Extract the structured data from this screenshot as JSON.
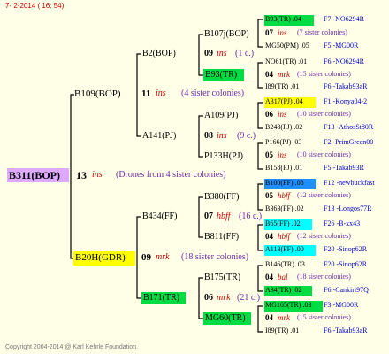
{
  "header": "7-  2-2014 ( 16: 54)",
  "copyright": "Copyright 2004-2014 @ Karl Kehrle Foundation.",
  "colors": {
    "green": "#00dd44",
    "cyan": "#00ffff",
    "yellow": "#ffff00",
    "blue": "#1e8fff",
    "lilac": "#ddaaff",
    "line": "#000000"
  },
  "tree": {
    "root": "B311(BOP)",
    "root_gen": "13",
    "root_ins": "ins",
    "root_note": "(Drones from 4 sister colonies)",
    "p1": {
      "name": "B109(BOP)",
      "gen": "11",
      "ins": "ins",
      "note": "(4 sister colonies)",
      "gp1": {
        "name": "B2(BOP)",
        "ggp1": {
          "name": "B107j(BOP)",
          "gen": "09",
          "ins": "ins",
          "note": "(1 c.)"
        },
        "ggp2": {
          "name": "B93(TR)"
        }
      },
      "gp2": {
        "name": "A141(PJ)",
        "ggp1": {
          "name": "A109(PJ)",
          "gen": "08",
          "ins": "ins",
          "note": "(9 c.)"
        },
        "ggp2": {
          "name": "P133H(PJ)"
        }
      }
    },
    "p2": {
      "name": "B20H(GDR)",
      "gen": "09",
      "ins": "mrk",
      "note": "(18 sister colonies)",
      "gp1": {
        "name": "B434(FF)",
        "ggp1": {
          "name": "B380(FF)",
          "gen": "07",
          "ins": "hbff",
          "note": "(16 c.)"
        },
        "ggp2": {
          "name": "B811(FF)"
        }
      },
      "gp2": {
        "name": "B171(TR)",
        "ggp1": {
          "name": "B175(TR)",
          "gen": "06",
          "ins": "mrk",
          "note": "(21 c.)"
        },
        "ggp2": {
          "name": "MG60(TR)"
        }
      }
    }
  },
  "right": [
    {
      "a": "B93(TR) .04",
      "b": "F7 -NO6294R"
    },
    {
      "gen": "07",
      "ins": "ins",
      "note": "(7 sister colonies)"
    },
    {
      "a": "MG50(PM) .05",
      "b": "F5 -MG00R"
    },
    {
      "a": "NO61(TR) .01",
      "b": "F6 -NO6294R"
    },
    {
      "gen": "04",
      "ins": "mrk",
      "note": "(15 sister colonies)"
    },
    {
      "a": "I89(TR) .01",
      "b": "F6 -Takab93aR"
    },
    {
      "a": "A317(PJ) .04",
      "b": "F1 -Konya04-2"
    },
    {
      "gen": "06",
      "ins": "ins",
      "note": "(10 sister colonies)"
    },
    {
      "a": "B248(PJ) .02",
      "b": "F13 -AthosSt80R"
    },
    {
      "a": "P166(PJ) .03",
      "b": "F2 -PrimGreen00"
    },
    {
      "gen": "05",
      "ins": "ins",
      "note": "(10 sister colonies)"
    },
    {
      "a": "B158(PJ) .01",
      "b": "F5 -Takab93R"
    },
    {
      "a": "B100(FF) .08",
      "b": "F12 -newbuckfast"
    },
    {
      "gen": "05",
      "ins": "hbff",
      "note": "(12 sister colonies)"
    },
    {
      "a": "B363(FF) .02",
      "b": "F13 -Longos77R"
    },
    {
      "a": "B65(FF) .02",
      "b": "F26 -B-xx43"
    },
    {
      "gen": "04",
      "ins": "hbff",
      "note": "(12 sister colonies)"
    },
    {
      "a": "A113(FF) .00",
      "b": "F20 -Sinop62R"
    },
    {
      "a": "B146(TR) .03",
      "b": "F20 -Sinop62R"
    },
    {
      "gen": "04",
      "ins": "bal",
      "note": "(18 sister colonies)"
    },
    {
      "a": "A34(TR) .02",
      "b": "F6 -Cankiri97Q"
    },
    {
      "a": "MG165(TR) .03",
      "b": "F3 -MG00R"
    },
    {
      "gen": "04",
      "ins": "mrk",
      "note": "(15 sister colonies)"
    },
    {
      "a": "I89(TR) .01",
      "b": "F6 -Takab93aR"
    }
  ]
}
